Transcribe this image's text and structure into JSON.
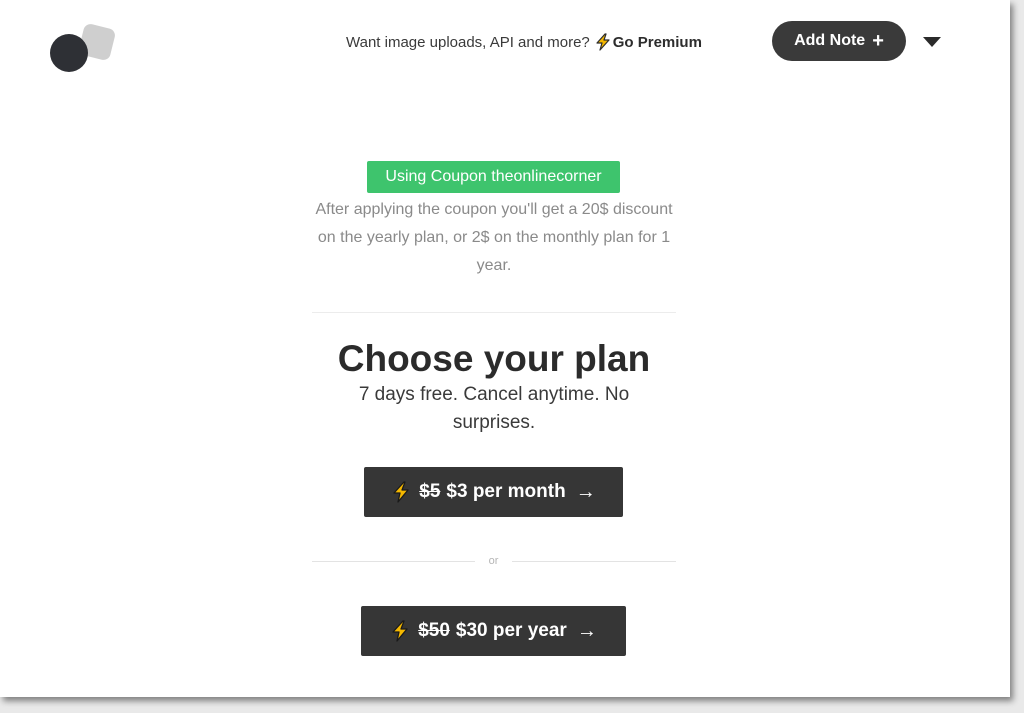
{
  "header": {
    "promo_text": "Want image uploads, API and more?",
    "premium_label": "Go Premium",
    "add_note_label": "Add Note",
    "add_note_icon": "+"
  },
  "coupon": {
    "badge_label": "Using Coupon theonlinecorner",
    "description": "After applying the coupon you'll get a 20$ discount on the yearly plan, or 2$ on the monthly plan for 1 year."
  },
  "plans": {
    "title": "Choose your plan",
    "subtitle": "7 days free. Cancel anytime. No surprises.",
    "monthly": {
      "old_price": "$5",
      "new_price": "$3 per month",
      "arrow": "→"
    },
    "or_label": "or",
    "yearly": {
      "old_price": "$50",
      "new_price": "$30 per year",
      "arrow": "→"
    }
  },
  "colors": {
    "coupon_green": "#3ec46d",
    "button_dark": "#363636",
    "bolt_yellow": "#f5b800"
  },
  "icons": {
    "logo": "app-logo",
    "bolt": "lightning-bolt-icon",
    "plus": "plus-icon",
    "caret": "caret-down-icon",
    "arrow": "arrow-right-icon"
  }
}
